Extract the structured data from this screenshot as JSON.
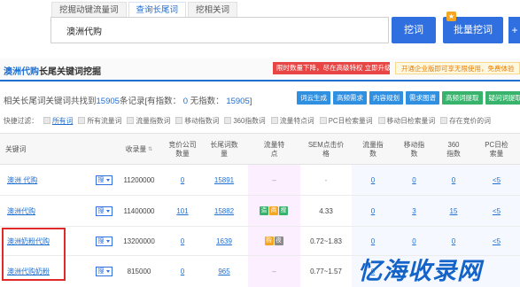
{
  "tabs": [
    "挖掘动键流量词",
    "查询长尾词",
    "挖相关词"
  ],
  "search": {
    "value": "澳洲代购",
    "button": "挖词",
    "batch_button": "批量挖词",
    "plus": "+"
  },
  "section": {
    "title_accent": "澳洲代购",
    "title_rest": "长尾关键词挖掘",
    "promo": "限时数量下降，尽在高级特权 立即升级",
    "notice": "开通企业版即可享无限使用，免费体验"
  },
  "summary": {
    "prefix": "相关长尾词关键词共找到",
    "count": "15905",
    "mid": "条记录[有指数：",
    "indexed": "0",
    "mid2": "无指数：",
    "unindexed": "15905",
    "suffix": "]"
  },
  "actions": [
    {
      "label": "词云生成",
      "color": "blue"
    },
    {
      "label": "高频需求",
      "color": "blue"
    },
    {
      "label": "内容规划",
      "color": "blue"
    },
    {
      "label": "需求图谱",
      "color": "blue"
    },
    {
      "label": "高频词提取",
      "color": "green"
    },
    {
      "label": "疑问词提取",
      "color": "green"
    }
  ],
  "filters": {
    "label": "快捷过滤：",
    "items": [
      {
        "label": "所有词",
        "active": true
      },
      {
        "label": "所有流量词",
        "active": false
      },
      {
        "label": "流量指数词",
        "active": false
      },
      {
        "label": "移动指数词",
        "active": false
      },
      {
        "label": "360指数词",
        "active": false
      },
      {
        "label": "流量特点词",
        "active": false
      },
      {
        "label": "PC日检索量词",
        "active": false
      },
      {
        "label": "移动日检索量词",
        "active": false
      },
      {
        "label": "存在竞价的词",
        "active": false
      }
    ]
  },
  "table": {
    "headers": [
      "关键词",
      "收录量",
      "竞价公司数量",
      "长尾词数量",
      "流量特点",
      "SEM点击价格",
      "流量指数",
      "移动指数",
      "360指数",
      "PC日检索量"
    ],
    "select_label": "搜",
    "rows": [
      {
        "keyword": "澳洲 代购",
        "volume": "11200000",
        "bid": "0",
        "longtail": "15891",
        "tags": [],
        "sem": "-",
        "traffic": "0",
        "mobile": "0",
        "s360": "0",
        "pc": "<5"
      },
      {
        "keyword": "澳洲代购",
        "volume": "11400000",
        "bid": "101",
        "longtail": "15882",
        "tags": [
          {
            "t": "造",
            "c": "#37b36b"
          },
          {
            "t": "商",
            "c": "#f5a623"
          },
          {
            "t": "搜",
            "c": "#37b36b"
          }
        ],
        "sem": "4.33",
        "traffic": "0",
        "mobile": "3",
        "s360": "15",
        "pc": "<5"
      },
      {
        "keyword": "澳洲奶粉代购",
        "volume": "13200000",
        "bid": "0",
        "longtail": "1639",
        "tags": [
          {
            "t": "购",
            "c": "#f5a623"
          },
          {
            "t": "夜",
            "c": "#8a8a8a"
          }
        ],
        "sem": "0.72~1.83",
        "traffic": "0",
        "mobile": "0",
        "s360": "0",
        "pc": "<5"
      },
      {
        "keyword": "澳洲代购奶粉",
        "volume": "815000",
        "bid": "0",
        "longtail": "965",
        "tags": [],
        "sem": "0.77~1.57",
        "traffic": "0",
        "mobile": "0",
        "s360": "0",
        "pc": "<5"
      }
    ]
  },
  "watermark": "忆海收录网"
}
